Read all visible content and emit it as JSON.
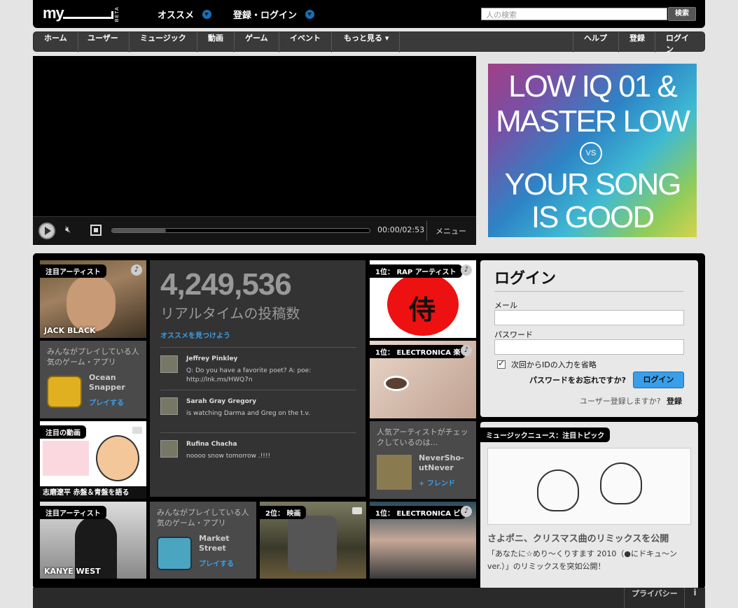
{
  "header": {
    "logo": "my",
    "beta": "BETA",
    "menu_recommended": "オススメ",
    "menu_login": "登録・ログイン",
    "search_placeholder": "人の検索",
    "search_button": "検索"
  },
  "nav": {
    "left": [
      "ホーム",
      "ユーザー",
      "ミュージック",
      "動画",
      "ゲーム",
      "イベント",
      "もっと見る ▾"
    ],
    "right": [
      "ヘルプ",
      "登録",
      "ログイン"
    ]
  },
  "player": {
    "time": "00:00/02:53",
    "menu_label": "メニュー",
    "progress": 0.21
  },
  "ad": {
    "line1": "LOW IQ 01 &",
    "line2": "MASTER LOW",
    "vs": "VS",
    "line3": "YOUR SONG",
    "line4": "IS GOOD"
  },
  "tiles": {
    "featured_artist_tag": "注目アーティスト",
    "jack_black_name": "JACK BLACK",
    "games_title": "みんながプレイしている人気のゲーム・アプリ",
    "ocean_app": "Ocean Snapper",
    "play_link": "プレイする",
    "video_tag": "注目の動画",
    "video_title": "志磨遼平 赤盤＆青盤を語る",
    "kanye_tag": "注目アーティスト",
    "kanye_name": "KANYE WEST",
    "games2_title": "みんながプレイしている人気のゲーム・アプリ",
    "market_app": "Market Street",
    "play_link2": "プレイする",
    "movie_tag": "2位： 映画",
    "rap_tag": "1位： RAP アーティスト",
    "electronica_tag": "1位： ELECTRONICA 楽",
    "popular_title": "人気アーティストがチェックしているのは…",
    "nevershoutnever": "NeverSho-utNever",
    "friend_link": "+ フレンド",
    "electronica2_tag": "1位： ELECTRONICA ビ"
  },
  "stats": {
    "count": "4,249,536",
    "label": "リアルタイムの投稿数",
    "find_link": "オススメを見つけよう",
    "posts": [
      {
        "user": "Jeffrey Pinkley",
        "text": "Q: Do you have a favorite poet? A: poe: http://lnk.ms/HWQ7n"
      },
      {
        "user": "Sarah Gray Gregory",
        "text": "is watching Darma and Greg on the t.v."
      },
      {
        "user": "Rufina Chacha",
        "text": "noooo snow tomorrow .!!!!"
      }
    ]
  },
  "login": {
    "title": "ログイン",
    "email_label": "メール",
    "password_label": "パスワード",
    "remember_label": "次回からIDの入力を省略",
    "forgot": "パスワードをお忘れですか?",
    "button": "ログイン",
    "signup_question": "ユーザー登録しますか?",
    "signup_link": "登録"
  },
  "news": {
    "tag": "ミュージックニュース：注目トピック",
    "title": "さよポニ、クリスマス曲のリミックスを公開",
    "body": "「あなたに☆めり〜くりすます 2010（●にドキュ〜ンver.）」のリミックスを突如公開！"
  },
  "footer": {
    "privacy": "プライバシー",
    "info": "i"
  },
  "colors": {
    "accent_blue": "#3a9ee8",
    "page_bg": "#e4e4e4"
  }
}
